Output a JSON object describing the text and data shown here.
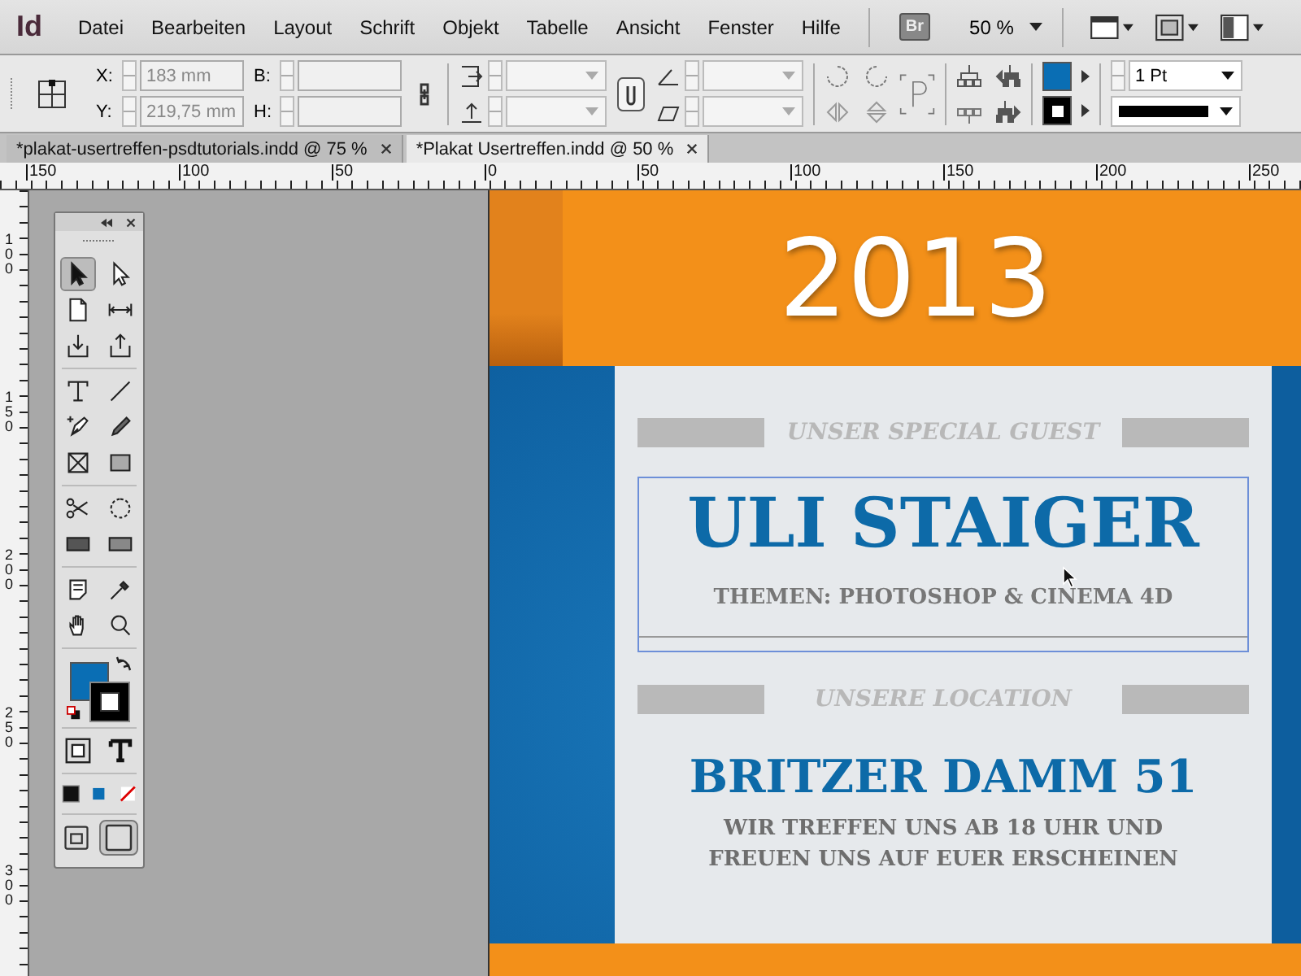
{
  "app": {
    "logo": "Id"
  },
  "menu": [
    {
      "label": "Datei"
    },
    {
      "label": "Bearbeiten"
    },
    {
      "label": "Layout"
    },
    {
      "label": "Schrift"
    },
    {
      "label": "Objekt"
    },
    {
      "label": "Tabelle"
    },
    {
      "label": "Ansicht"
    },
    {
      "label": "Fenster"
    },
    {
      "label": "Hilfe"
    }
  ],
  "app_bar": {
    "bridge": "Br",
    "zoom": "50 %"
  },
  "control_panel": {
    "x_label": "X:",
    "x_value": "183 mm",
    "y_label": "Y:",
    "y_value": "219,75 mm",
    "w_label": "B:",
    "h_label": "H:",
    "stroke_weight": "1 Pt"
  },
  "tabs": [
    {
      "label": "*plakat-usertreffen-psdtutorials.indd @ 75 %",
      "selected": false
    },
    {
      "label": "*Plakat Usertreffen.indd @ 50 %",
      "selected": true
    }
  ],
  "ruler": {
    "horizontal": [
      "150",
      "100",
      "50",
      "0",
      "50",
      "100",
      "150",
      "200",
      "250"
    ],
    "vertical": [
      "100",
      "150",
      "200",
      "250",
      "300"
    ]
  },
  "tools_panel": {
    "groups": [
      [
        {
          "kind": "selection",
          "selected": true
        },
        {
          "kind": "direct-selection",
          "selected": false
        },
        {
          "kind": "page",
          "selected": false
        },
        {
          "kind": "gap",
          "selected": false
        },
        {
          "kind": "collector",
          "selected": false
        },
        {
          "kind": "placer",
          "selected": false
        }
      ],
      [
        {
          "kind": "type",
          "selected": false
        },
        {
          "kind": "line",
          "selected": false
        },
        {
          "kind": "pen",
          "selected": false
        },
        {
          "kind": "pencil",
          "selected": false
        },
        {
          "kind": "frame",
          "selected": false
        },
        {
          "kind": "rectangle",
          "selected": false
        }
      ],
      [
        {
          "kind": "scissors",
          "selected": false
        },
        {
          "kind": "rotate",
          "selected": false
        },
        {
          "kind": "gradient",
          "selected": false
        },
        {
          "kind": "feather",
          "selected": false
        }
      ],
      [
        {
          "kind": "note",
          "selected": false
        },
        {
          "kind": "eyedropper",
          "selected": false
        },
        {
          "kind": "hand",
          "selected": false
        },
        {
          "kind": "zoom",
          "selected": false
        }
      ]
    ],
    "view_modes": [
      {
        "kind": "normal",
        "selected": false
      },
      {
        "kind": "preview",
        "selected": true
      }
    ]
  },
  "poster": {
    "year": "2013",
    "guest_label": "UNSER SPECIAL GUEST",
    "guest_frame_selected": true,
    "guest_name": "ULI STAIGER",
    "topics": "THEMEN: PHOTOSHOP & CINEMA 4D",
    "location_label": "UNSERE LOCATION",
    "address": "BRITZER DAMM 51",
    "note": "WIR TREFFEN UNS AB 18 UHR UND FREUEN UNS AUF EUER ERSCHEINEN"
  }
}
